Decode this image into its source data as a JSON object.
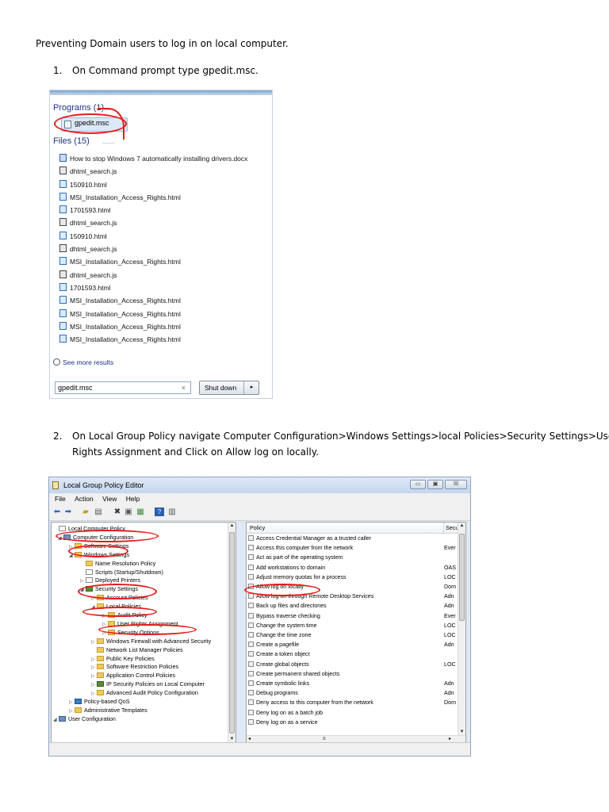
{
  "intro": "Preventing Domain users to log in on local computer.",
  "step1": {
    "number": "1.",
    "text": "On Command prompt type gpedit.msc."
  },
  "start_menu": {
    "programs_header": "Programs (1)",
    "program_item": "gpedit.msc",
    "files_header": "Files (15)",
    "files": [
      {
        "name": "How to stop Windows 7 automatically installing drivers.docx",
        "icon": "word-doc-icon"
      },
      {
        "name": "dhtml_search.js",
        "icon": "script-file-icon"
      },
      {
        "name": "150910.html",
        "icon": "ie-html-icon"
      },
      {
        "name": "MSI_Installation_Access_Rights.html",
        "icon": "ie-html-icon"
      },
      {
        "name": "1701593.html",
        "icon": "ie-html-icon"
      },
      {
        "name": "dhtml_search.js",
        "icon": "script-file-icon"
      },
      {
        "name": "150910.html",
        "icon": "ie-html-icon"
      },
      {
        "name": "dhtml_search.js",
        "icon": "script-file-icon"
      },
      {
        "name": "MSI_Installation_Access_Rights.html",
        "icon": "ie-html-icon"
      },
      {
        "name": "dhtml_search.js",
        "icon": "script-file-icon"
      },
      {
        "name": "1701593.html",
        "icon": "ie-html-icon"
      },
      {
        "name": "MSI_Installation_Access_Rights.html",
        "icon": "ie-html-icon"
      },
      {
        "name": "MSI_Installation_Access_Rights.html",
        "icon": "ie-html-icon"
      },
      {
        "name": "MSI_Installation_Access_Rights.html",
        "icon": "ie-html-icon"
      },
      {
        "name": "MSI_Installation_Access_Rights.html",
        "icon": "ie-html-icon"
      }
    ],
    "see_more": "See more results",
    "search_value": "gpedit.msc",
    "clear_glyph": "×",
    "shutdown_label": "Shut down",
    "shutdown_arrow": "▸"
  },
  "step2": {
    "number": "2.",
    "line1": "On Local Group Policy navigate Computer Configuration>Windows Settings>local Policies>Security Settings>User",
    "line2": "Rights Assignment and Click on Allow log on locally."
  },
  "gpedit": {
    "title": "Local Group Policy Editor",
    "window_buttons": {
      "minimize": "▭",
      "maximize": "▣",
      "close": "☒"
    },
    "menu": [
      "File",
      "Action",
      "View",
      "Help"
    ],
    "tree": [
      {
        "label": "Local Computer Policy",
        "icon": "policy-icon",
        "twisty": ""
      },
      {
        "label": "Computer Configuration",
        "icon": "computer-icon",
        "twisty": "◢"
      },
      {
        "label": "Software Settings",
        "icon": "folder-icon",
        "twisty": "▷"
      },
      {
        "label": "Windows Settings",
        "icon": "folder-icon",
        "twisty": "◢"
      },
      {
        "label": "Name Resolution Policy",
        "icon": "folder-icon",
        "twisty": ""
      },
      {
        "label": "Scripts (Startup/Shutdown)",
        "icon": "script-icon",
        "twisty": ""
      },
      {
        "label": "Deployed Printers",
        "icon": "printer-icon",
        "twisty": "▷"
      },
      {
        "label": "Security Settings",
        "icon": "security-icon",
        "twisty": "◢"
      },
      {
        "label": "Account Policies",
        "icon": "folder-icon",
        "twisty": "▷"
      },
      {
        "label": "Local Policies",
        "icon": "folder-icon",
        "twisty": "◢"
      },
      {
        "label": "Audit Policy",
        "icon": "folder-icon",
        "twisty": "▷"
      },
      {
        "label": "User Rights Assignment",
        "icon": "folder-icon",
        "twisty": "▷"
      },
      {
        "label": "Security Options",
        "icon": "folder-icon",
        "twisty": "▷"
      },
      {
        "label": "Windows Firewall with Advanced Security",
        "icon": "folder-icon",
        "twisty": "▷"
      },
      {
        "label": "Network List Manager Policies",
        "icon": "folder-icon",
        "twisty": ""
      },
      {
        "label": "Public Key Policies",
        "icon": "folder-icon",
        "twisty": "▷"
      },
      {
        "label": "Software Restriction Policies",
        "icon": "folder-icon",
        "twisty": "▷"
      },
      {
        "label": "Application Control Policies",
        "icon": "folder-icon",
        "twisty": "▷"
      },
      {
        "label": "IP Security Policies on Local Computer",
        "icon": "ip-security-icon",
        "twisty": "▷"
      },
      {
        "label": "Advanced Audit Policy Configuration",
        "icon": "folder-icon",
        "twisty": "▷"
      },
      {
        "label": "Policy-based QoS",
        "icon": "chart-icon",
        "twisty": "▷"
      },
      {
        "label": "Administrative Templates",
        "icon": "folder-icon",
        "twisty": "▷"
      },
      {
        "label": "User Configuration",
        "icon": "user-icon",
        "twisty": "◢"
      }
    ],
    "columns": {
      "policy": "Policy",
      "security": "Secu"
    },
    "policies": [
      {
        "name": "Access Credential Manager as a trusted caller",
        "value": ""
      },
      {
        "name": "Access this computer from the network",
        "value": "Ever"
      },
      {
        "name": "Act as part of the operating system",
        "value": ""
      },
      {
        "name": "Add workstations to domain",
        "value": "OAS"
      },
      {
        "name": "Adjust memory quotas for a process",
        "value": "LOC"
      },
      {
        "name": "Allow log on locally",
        "value": "Dom"
      },
      {
        "name": "Allow log on through Remote Desktop Services",
        "value": "Adn"
      },
      {
        "name": "Back up files and directories",
        "value": "Adn"
      },
      {
        "name": "Bypass traverse checking",
        "value": "Ever"
      },
      {
        "name": "Change the system time",
        "value": "LOC"
      },
      {
        "name": "Change the time zone",
        "value": "LOC"
      },
      {
        "name": "Create a pagefile",
        "value": "Adn"
      },
      {
        "name": "Create a token object",
        "value": ""
      },
      {
        "name": "Create global objects",
        "value": "LOC"
      },
      {
        "name": "Create permanent shared objects",
        "value": ""
      },
      {
        "name": "Create symbolic links",
        "value": "Adn"
      },
      {
        "name": "Debug programs",
        "value": "Adn"
      },
      {
        "name": "Deny access to this computer from the network",
        "value": "Dom"
      },
      {
        "name": "Deny log on as a batch job",
        "value": ""
      },
      {
        "name": "Deny log on as a service",
        "value": ""
      }
    ],
    "scroll_glyphs": {
      "up": "▲",
      "down": "▼",
      "left": "◂",
      "right": "▸",
      "grip": "≡"
    },
    "annotation_color": "#e51b1b"
  }
}
